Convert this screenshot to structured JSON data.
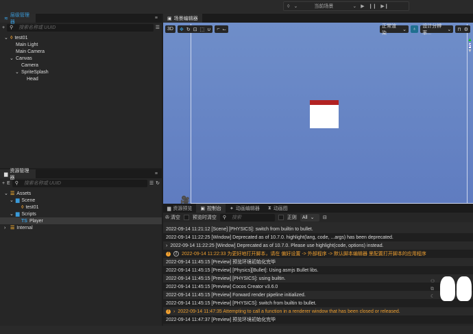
{
  "topbar": {
    "scene_select": "当前场景",
    "icons": [
      "cocos-icon",
      "chevron-down-icon",
      "play-icon",
      "pause-icon",
      "step-icon"
    ]
  },
  "hierarchy": {
    "tab": "层级管理器",
    "search_placeholder": "搜索名称或 UUID",
    "items": [
      {
        "label": "test01",
        "depth": 0,
        "expanded": true,
        "icon": "scene-icon"
      },
      {
        "label": "Main Light",
        "depth": 1
      },
      {
        "label": "Main Camera",
        "depth": 1
      },
      {
        "label": "Canvas",
        "depth": 1,
        "expanded": true
      },
      {
        "label": "Camera",
        "depth": 2
      },
      {
        "label": "SpriteSplash",
        "depth": 2,
        "expanded": true
      },
      {
        "label": "Head",
        "depth": 3
      }
    ]
  },
  "assets": {
    "tab": "资源管理器",
    "search_placeholder": "搜索名称或 UUID",
    "items": [
      {
        "label": "Assets",
        "depth": 0,
        "expanded": true,
        "icon": "db-icon"
      },
      {
        "label": "Scene",
        "depth": 1,
        "expanded": true,
        "icon": "folder-icon"
      },
      {
        "label": "test01",
        "depth": 2,
        "icon": "scene-icon"
      },
      {
        "label": "Scripts",
        "depth": 1,
        "expanded": true,
        "icon": "folder-icon"
      },
      {
        "label": "Player",
        "depth": 2,
        "icon": "ts-icon",
        "selected": true
      },
      {
        "label": "Internal",
        "depth": 0,
        "expanded": false,
        "icon": "db-icon"
      }
    ]
  },
  "scene": {
    "tab": "场景编辑器",
    "btn_3d": "3D",
    "render_mode": "正常渲染",
    "resolution": "设计分辨率...",
    "sprite_colors": {
      "top": "#b22222",
      "body": "#ffffff"
    }
  },
  "console": {
    "tabs": [
      "资源预览",
      "控制台",
      "动画编辑器",
      "动画图"
    ],
    "active_tab": 1,
    "clear": "清空",
    "clear_on_preview": "预览时清空",
    "search_placeholder": "搜索",
    "regex": "正则",
    "level": "All",
    "logs": [
      {
        "text": "2022-09-14 11:21:12 [Scene] [PHYSICS]: switch from builtin to bullet."
      },
      {
        "text": "2022-09-14 11:22:25 [Window] Deprecated as of 10.7.0. highlight(lang, code, ...args) has been deprecated."
      },
      {
        "text": "2022-09-14 11:22:25 [Window] Deprecated as of 10.7.0. Please use highlight(code, options) instead.",
        "arrow": true
      },
      {
        "text": "2022-09-14 11:22:33 为更好地打开脚本，请在 偏好设置 -> 外部程序 -> 默认脚本编辑器 里配置打开脚本的应用程序",
        "warn": true,
        "count": "2"
      },
      {
        "text": "2022-09-14 11:45:15 [Preview] 预览环境初始化完毕"
      },
      {
        "text": "2022-09-14 11:45:15 [Preview] [Physics][Bullet]: Using asmjs Bullet libs."
      },
      {
        "text": "2022-09-14 11:45:15 [Preview] [PHYSICS]: using builtin."
      },
      {
        "text": "2022-09-14 11:45:15 [Preview] Cocos Creator v3.6.0"
      },
      {
        "text": "2022-09-14 11:45:15 [Preview] Forward render pipeline initialized."
      },
      {
        "text": "2022-09-14 11:45:15 [Preview] [PHYSICS]: switch from builtin to bullet."
      },
      {
        "text": "2022-09-14 11:47:35 Attempting to call a function in a renderer window that has been closed or released.",
        "warn": true,
        "arrow": true
      },
      {
        "text": "2022-09-14 11:47:37 [Preview] 预览环境初始化完毕"
      }
    ]
  },
  "colors": {
    "accent": "#3a9ad9",
    "warning": "#f0a030",
    "viewport": "#6a88c6"
  }
}
